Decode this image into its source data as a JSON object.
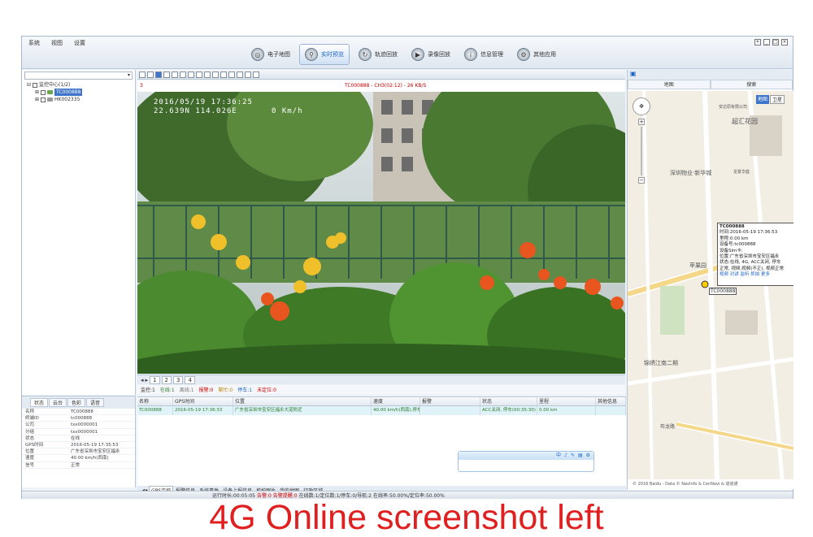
{
  "menu": [
    "系统",
    "视图",
    "设置"
  ],
  "nav": [
    {
      "label": "电子地图",
      "icon": "map-icon",
      "active": false
    },
    {
      "label": "实时预览",
      "icon": "search-icon",
      "active": true
    },
    {
      "label": "轨迹回放",
      "icon": "track-icon",
      "active": false
    },
    {
      "label": "录像回放",
      "icon": "playback-icon",
      "active": false
    },
    {
      "label": "信息管理",
      "icon": "info-icon",
      "active": false
    },
    {
      "label": "其他应用",
      "icon": "settings-icon",
      "active": false
    }
  ],
  "tree": {
    "root": "监控中心(1/2)",
    "items": [
      "TC000888",
      "HK002335"
    ]
  },
  "info_tabs": [
    "状态",
    "云台",
    "色彩",
    "语音"
  ],
  "info": [
    {
      "k": "名称",
      "v": "TC000888"
    },
    {
      "k": "终端ID",
      "v": "tc000888"
    },
    {
      "k": "公司",
      "v": "txx0000001"
    },
    {
      "k": "分组",
      "v": "txx0000001"
    },
    {
      "k": "状态",
      "v": "在线"
    },
    {
      "k": "GPS时间",
      "v": "2016-05-19 17:35:53"
    },
    {
      "k": "位置",
      "v": "广东省深圳市宝安区福永"
    },
    {
      "k": "速度",
      "v": "40.00 km/h(西南)"
    },
    {
      "k": "信号",
      "v": "正常"
    }
  ],
  "video": {
    "index": "3",
    "header": "TC000888 - CH3(02:12) - 26 KB/S",
    "osd_time": "2016/05/19 17:36:25",
    "osd_coord": "22.639N 114.026E",
    "osd_speed": "0 Km/h"
  },
  "pages": [
    "1",
    "2",
    "3",
    "4"
  ],
  "status_line": [
    "监控:1",
    "在线:1",
    "离线:1",
    "报警:0",
    "繁忙:0",
    "停车:1",
    "未定位:0"
  ],
  "gps_table": {
    "headers": [
      "名称",
      "GPS时间",
      "位置",
      "速度",
      "报警",
      "状态",
      "里程",
      "其他信息"
    ],
    "rows": [
      [
        "TC000888",
        "2016-05-19 17:36:33",
        "广东省深圳市宝安区福永大道附近",
        "40.00 km/h(西南),停车(",
        "",
        "ACC关闭, 停车(00:35:30)",
        "0.00 km",
        ""
      ]
    ]
  },
  "chat_icons": [
    "中",
    "♪",
    "✎",
    "▤",
    "⚙"
  ],
  "bottom_tabs": [
    "GPS监控",
    "报警信息",
    "系统事件",
    "设备上报信息",
    "抓拍图片",
    "我的地图",
    "行政区域"
  ],
  "statusbar": {
    "run": "运行时长:00:05:05",
    "alarm": "告警:0 告警提醒:0",
    "online": "在线数:1/定位数:1/停车:0/导航:2",
    "rate": "在线率:50.00%/定位率:50.00%"
  },
  "map": {
    "tabs": [
      "地图",
      "搜索"
    ],
    "type_buttons": [
      "地图",
      "卫星"
    ],
    "popup": {
      "title": "TC000888",
      "lines": [
        "时间:2016-05-19 17:36:53",
        "里程:0.00 km",
        "设备号:tc000888",
        "设备Sim卡:",
        "位置:广东省深圳市宝安区福永",
        "状态:在线, 4G, ACC关闭, 停车",
        "正常, 视频,视频(不正), 视频正常"
      ],
      "links": "视频 对讲 监听 抓拍 更多"
    },
    "vehicle_label": "TC000888",
    "labels": [
      "超汇花园",
      "深圳物业·新华城",
      "苹果园",
      "锦绣江南二期",
      "布龙路",
      "安达原有限公司",
      "龙景华庭"
    ],
    "footer": "© 2016 Baidu - Data © NavInfo & CenNavi & 道道通"
  },
  "caption": "4G Online screenshot left"
}
